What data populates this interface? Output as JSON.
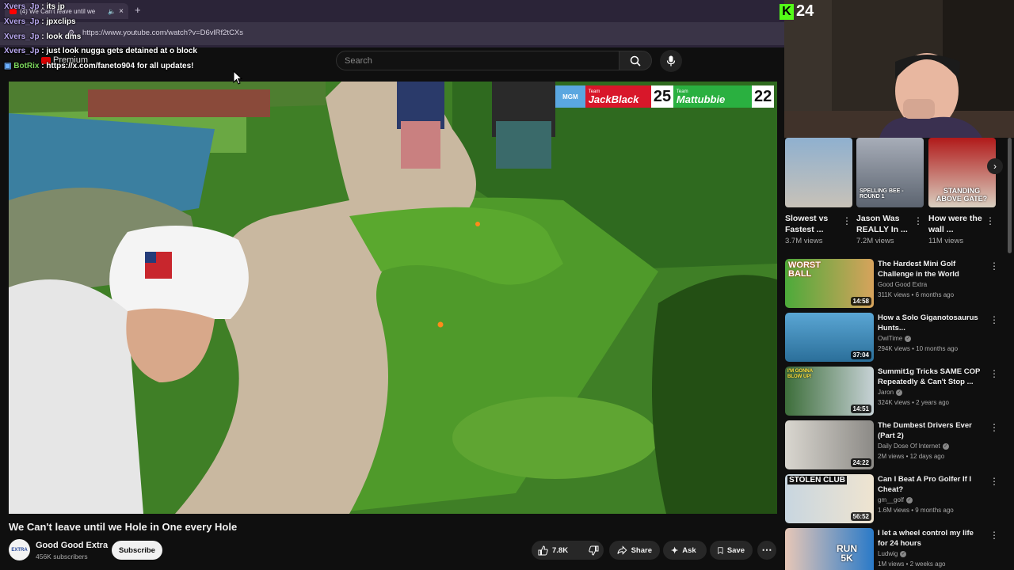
{
  "browser": {
    "tab_title": "(4) We Can't leave until we",
    "url": "https://www.youtube.com/watch?v=D6vlRf2tCXs"
  },
  "youtube": {
    "logo_text": "Premium",
    "search_placeholder": "Search"
  },
  "chat": [
    {
      "user": "Xvers_Jp",
      "message": "its jp",
      "user_color": "#b9a8f0"
    },
    {
      "user": "Xvers_Jp",
      "message": "jpxclips",
      "user_color": "#b9a8f0"
    },
    {
      "user": "Xvers_Jp",
      "message": "look dms",
      "user_color": "#b9a8f0"
    },
    {
      "user": "Xvers_Jp",
      "message": "just look nugga gets detained at o block",
      "user_color": "#b9a8f0"
    },
    {
      "user": "BotRix",
      "message": "https://x.com/faneto904 for all updates!",
      "user_color": "#7bd65c"
    }
  ],
  "scoreboard": {
    "logo": "MGM",
    "team_a_prefix": "Team",
    "team_a_name": "JackBlack",
    "team_a_score": "25",
    "team_b_prefix": "Team",
    "team_b_name": "Mattubbie",
    "team_b_score": "22"
  },
  "video": {
    "title": "We Can't leave until we Hole in One every Hole",
    "channel": "Good Good Extra",
    "avatar_text": "EXTRA",
    "subscribers": "456K subscribers",
    "subscribe_label": "Subscribe",
    "likes": "7.8K",
    "share_label": "Share",
    "ask_label": "Ask",
    "save_label": "Save"
  },
  "stream": {
    "viewer_count": "24",
    "kick_color": "#53fc18"
  },
  "shorts": [
    {
      "title": "Slowest vs Fastest ...",
      "views": "3.7M views"
    },
    {
      "title": "Jason Was REALLY In ...",
      "views": "7.2M views",
      "thumb_text": "SPELLING BEE - ROUND 1"
    },
    {
      "title": "How were the wall ...",
      "views": "11M views",
      "thumb_text": "STANDING ABOVE GATE?"
    }
  ],
  "recommendations": [
    {
      "title": "The Hardest Mini Golf Challenge in the World",
      "channel": "Good Good Extra",
      "verified": false,
      "meta": "311K views • 6 months ago",
      "duration": "14:58",
      "thumb_text": "WORST BALL"
    },
    {
      "title": "How a Solo Giganotosaurus Hunts...",
      "channel": "OwlTime",
      "verified": true,
      "meta": "294K views • 10 months ago",
      "duration": "37:04",
      "thumb_text": ""
    },
    {
      "title": "Summit1g Tricks SAME COP Repeatedly & Can't Stop ...",
      "channel": "Jaron",
      "verified": true,
      "meta": "324K views • 2 years ago",
      "duration": "14:51",
      "thumb_text": "I'M GONNA BLOW UP!"
    },
    {
      "title": "The Dumbest Drivers Ever (Part 2)",
      "channel": "Daily Dose Of Internet",
      "verified": true,
      "meta": "2M views • 12 days ago",
      "duration": "24:22",
      "thumb_text": ""
    },
    {
      "title": "Can I Beat A Pro Golfer If I Cheat?",
      "channel": "gm__golf",
      "verified": true,
      "meta": "1.6M views • 9 months ago",
      "duration": "56:52",
      "thumb_text": "STOLEN CLUB"
    },
    {
      "title": "I let a wheel control my life for 24 hours",
      "channel": "Ludwig",
      "verified": true,
      "meta": "1M views • 2 weeks ago",
      "duration": "",
      "thumb_text": "RUN 5K"
    }
  ]
}
